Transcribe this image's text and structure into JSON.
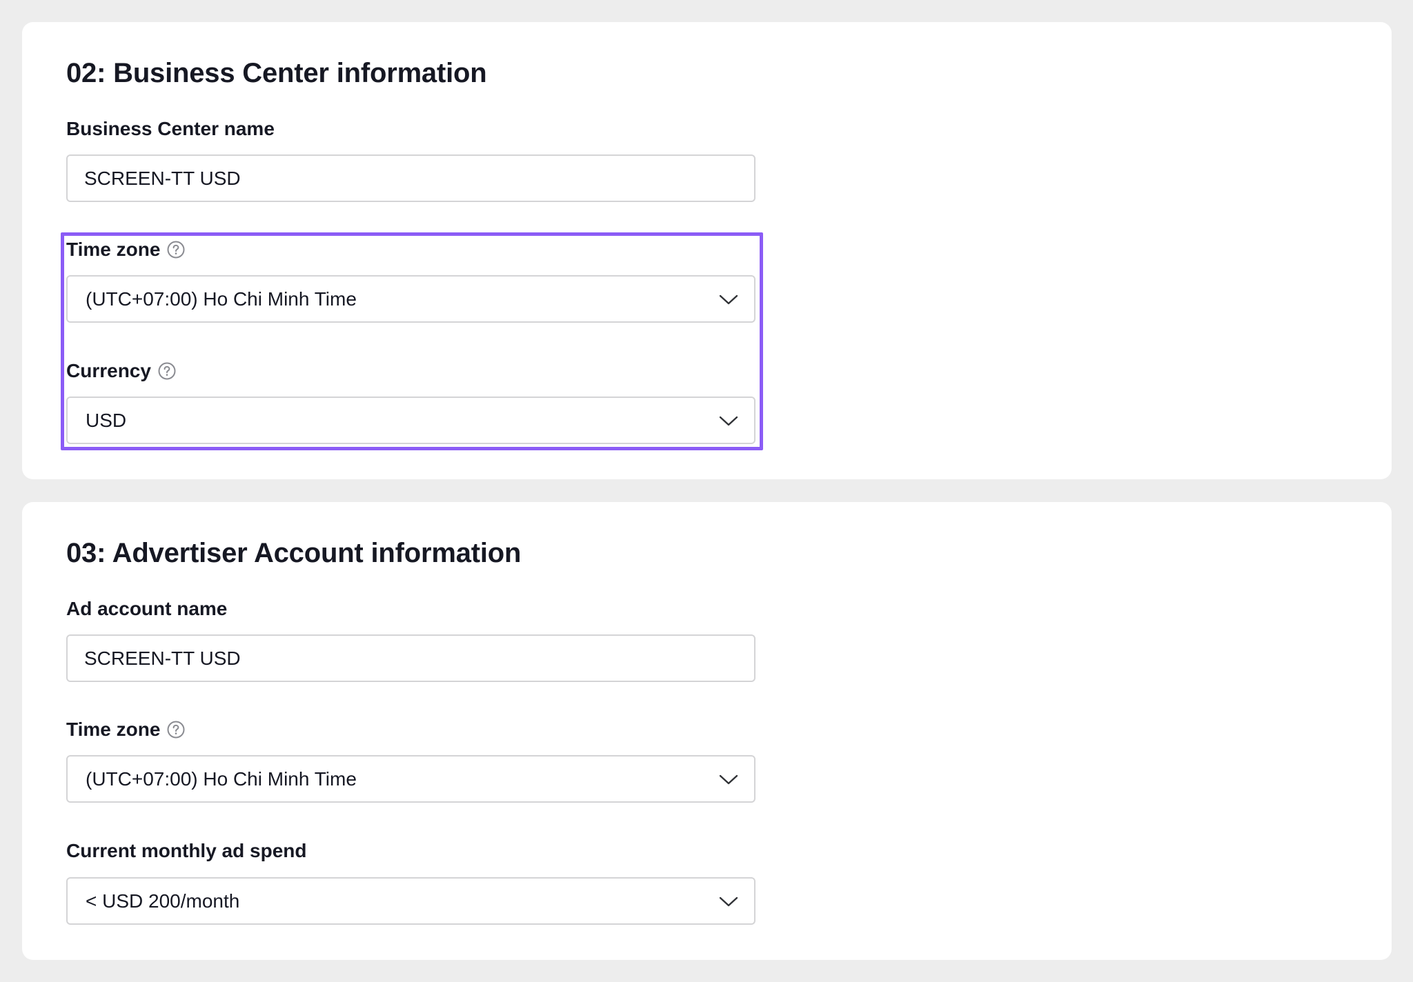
{
  "business_center": {
    "title": "02: Business Center information",
    "name_label": "Business Center name",
    "name_value": "SCREEN-TT USD",
    "timezone_label": "Time zone",
    "timezone_value": "(UTC+07:00) Ho Chi Minh Time",
    "currency_label": "Currency",
    "currency_value": "USD"
  },
  "advertiser_account": {
    "title": "03: Advertiser Account information",
    "name_label": "Ad account name",
    "name_value": "SCREEN-TT USD",
    "timezone_label": "Time zone",
    "timezone_value": "(UTC+07:00) Ho Chi Minh Time",
    "spend_label": "Current monthly ad spend",
    "spend_value": "< USD 200/month"
  },
  "colors": {
    "highlight": "#8b5cf6",
    "background": "#ededed",
    "card": "#ffffff",
    "border": "#d4d4d6",
    "text": "#161823"
  },
  "icons": {
    "help": "question-circle-icon",
    "dropdown": "chevron-down-icon"
  }
}
